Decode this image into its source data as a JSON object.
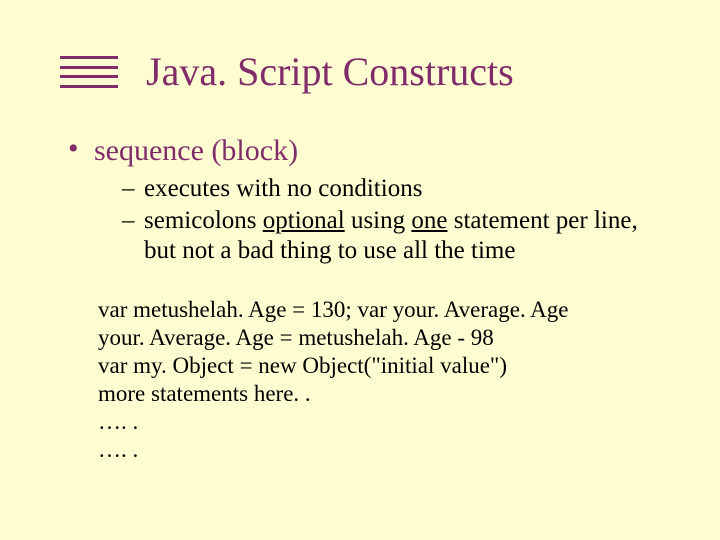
{
  "title": "Java. Script Constructs",
  "bullet1": "sequence (block)",
  "sub1": "executes with no conditions",
  "sub2_pre": "semicolons ",
  "sub2_u1": "optional",
  "sub2_mid": " using ",
  "sub2_u2": "one",
  "sub2_post": " statement per line, but not a bad thing to use all the time",
  "code": {
    "l1": "var metushelah. Age = 130; var your. Average. Age",
    "l2": "your. Average. Age = metushelah. Age - 98",
    "l3": "var my. Object = new Object(\"initial value\")",
    "l4": "more statements here. .",
    "l5": "…. .",
    "l6": "…. ."
  }
}
